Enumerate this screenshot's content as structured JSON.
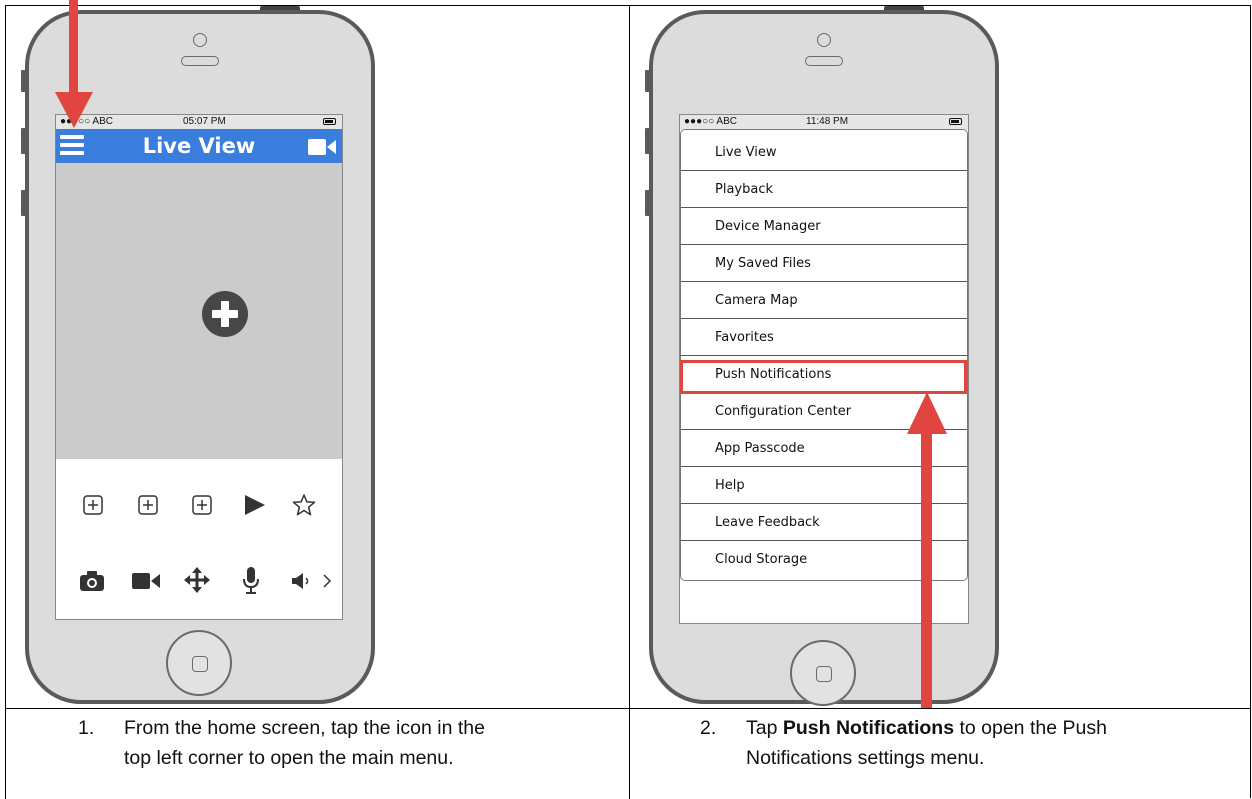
{
  "left_phone": {
    "status_carrier": "●●●○○ ABC",
    "status_time": "05:07 PM",
    "header_title": "Live View",
    "header_color": "#3b7ddd",
    "toolbar1_icons": [
      "add-box-icon",
      "add-box-icon",
      "add-box-icon",
      "play-icon",
      "star-icon"
    ],
    "toolbar2_icons": [
      "camera-icon",
      "video-icon",
      "move-icon",
      "microphone-icon",
      "speaker-icon",
      "chevron-right-icon"
    ]
  },
  "right_phone": {
    "status_carrier": "●●●○○ ABC",
    "status_time": "11:48 PM",
    "menu_items": [
      "Live View",
      "Playback",
      "Device Manager",
      "My Saved Files",
      "Camera Map",
      "Favorites",
      "Push Notifications",
      "Configuration Center",
      "App Passcode",
      "Help",
      "Leave Feedback",
      "Cloud Storage"
    ],
    "highlighted_item": "Push Notifications",
    "highlight_color": "#e0453f"
  },
  "steps": [
    {
      "number": "1.",
      "line1": "From the home screen, tap the icon in the",
      "line2": "top left corner to open the main menu."
    },
    {
      "number": "2.",
      "line1_pre": "Tap ",
      "line1_bold": "Push Notifications",
      "line1_post": " to open the Push",
      "line2": "Notifications settings menu."
    }
  ]
}
